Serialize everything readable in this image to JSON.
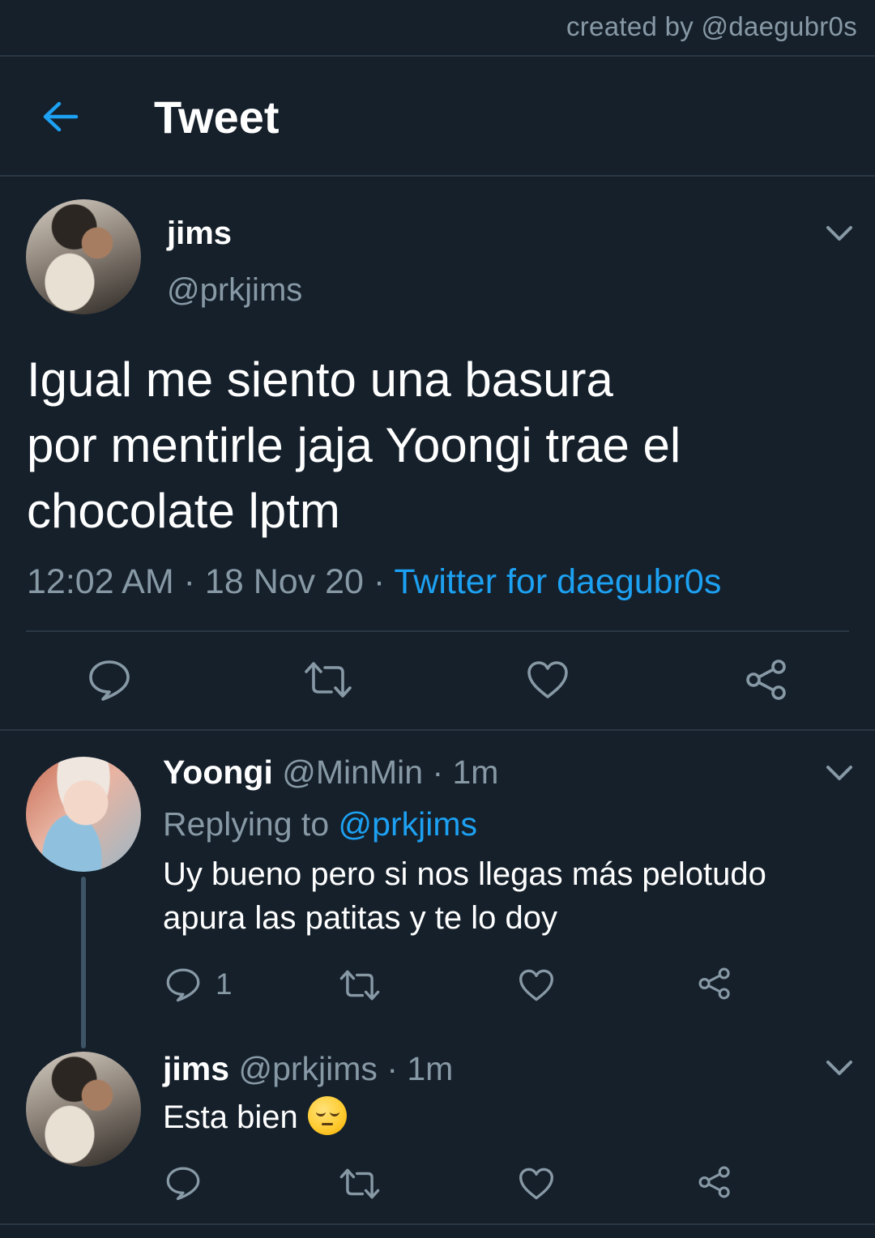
{
  "credit": "created by @daegubr0s",
  "header": {
    "title": "Tweet",
    "back_icon": "arrow-left-icon"
  },
  "main_tweet": {
    "name": "jims",
    "handle": "@prkjims",
    "text_lines": [
      "Igual me siento una basura",
      "por mentirle jaja Yoongi trae el",
      "chocolate lptm"
    ],
    "time": "12:02 AM",
    "date": "18 Nov 20",
    "source": "Twitter for daegubr0s"
  },
  "replies": [
    {
      "name": "Yoongi",
      "handle": "@MinMin",
      "age": "1m",
      "replying_label": "Replying to",
      "replying_to": "@prkjims",
      "text_lines": [
        "Uy bueno pero si nos llegas más pelotudo",
        "apura las patitas y te lo doy"
      ],
      "reply_count": "1"
    },
    {
      "name": "jims",
      "handle": "@prkjims",
      "age": "1m",
      "text": "Esta bien",
      "emoji": "pensive-face-emoji"
    }
  ],
  "separator": "·",
  "colors": {
    "background": "#15202b",
    "accent": "#1da1f2",
    "muted": "#8899a6",
    "divider": "#2a3744"
  }
}
